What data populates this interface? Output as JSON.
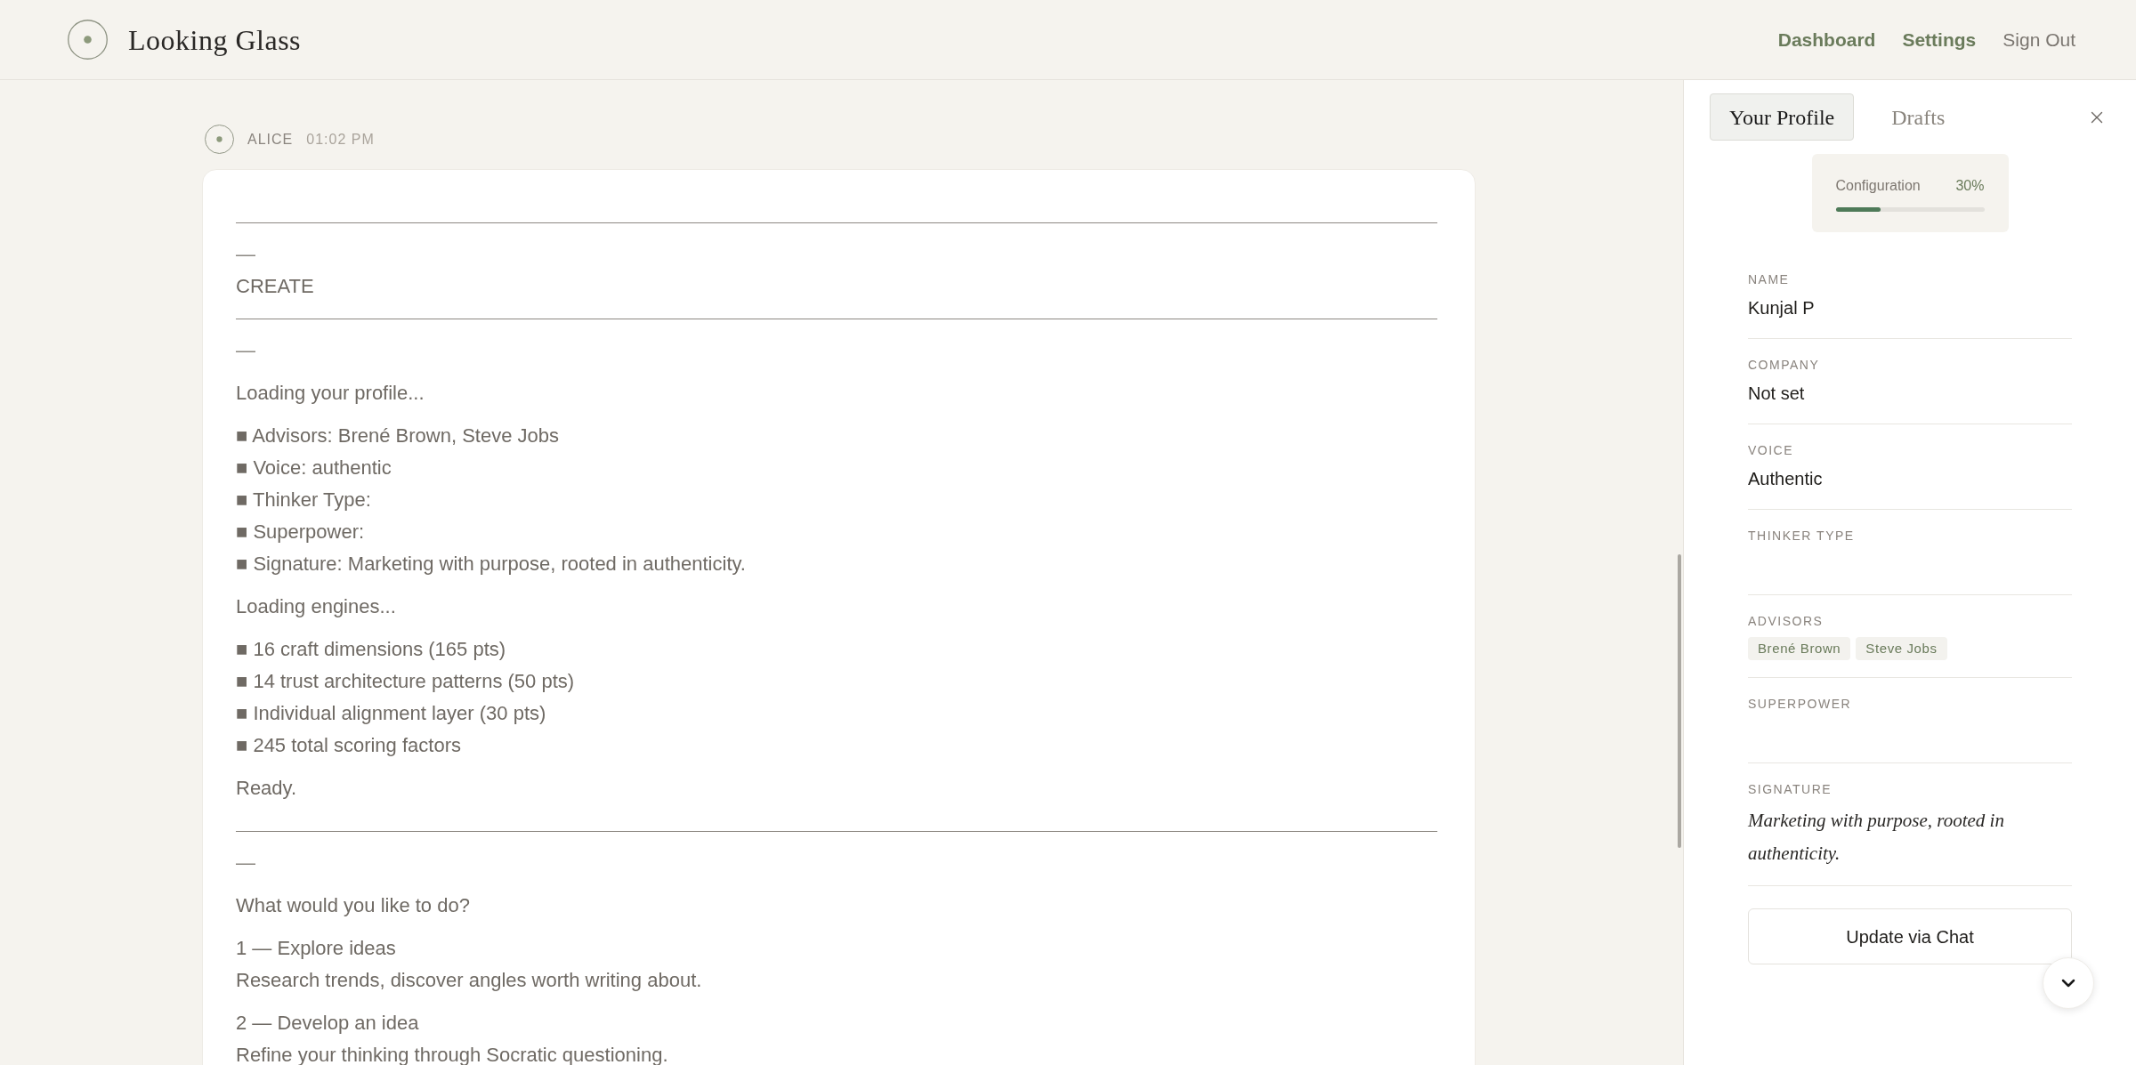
{
  "header": {
    "title": "Looking Glass",
    "links": [
      {
        "label": "Dashboard",
        "kind": "primary"
      },
      {
        "label": "Settings",
        "kind": "primary"
      },
      {
        "label": "Sign Out",
        "kind": "secondary"
      }
    ]
  },
  "message": {
    "sender": "ALICE",
    "time": "01:02 PM",
    "blocks": [
      {
        "kind": "rule"
      },
      {
        "kind": "dash",
        "text": "—"
      },
      {
        "kind": "heading",
        "text": "CREATE"
      },
      {
        "kind": "rule"
      },
      {
        "kind": "dash",
        "text": "—"
      },
      {
        "kind": "paragraph",
        "lines": [
          "Loading your profile..."
        ]
      },
      {
        "kind": "list",
        "items": [
          "■ Advisors: Brené Brown, Steve Jobs",
          "■ Voice: authentic",
          "■ Thinker Type:",
          "■ Superpower:",
          "■ Signature: Marketing with purpose, rooted in authenticity."
        ]
      },
      {
        "kind": "paragraph",
        "lines": [
          "Loading engines..."
        ]
      },
      {
        "kind": "list",
        "items": [
          "■ 16 craft dimensions (165 pts)",
          "■ 14 trust architecture patterns (50 pts)",
          "■ Individual alignment layer (30 pts)",
          "■ 245 total scoring factors"
        ]
      },
      {
        "kind": "paragraph",
        "lines": [
          "Ready."
        ]
      },
      {
        "kind": "rule"
      },
      {
        "kind": "dash",
        "text": "—"
      },
      {
        "kind": "paragraph",
        "lines": [
          "What would you like to do?"
        ]
      },
      {
        "kind": "paragraph",
        "lines": [
          "1 — Explore ideas",
          "Research trends, discover angles worth writing about."
        ]
      },
      {
        "kind": "paragraph",
        "lines": [
          "2 — Develop an idea",
          "Refine your thinking through Socratic questioning."
        ]
      }
    ]
  },
  "panel": {
    "tabs": [
      {
        "label": "Your Profile",
        "selected": true
      },
      {
        "label": "Drafts",
        "selected": false
      }
    ],
    "progress": {
      "label": "Configuration",
      "reading": "30%",
      "level": 0.3
    },
    "fields": [
      {
        "label": "NAME",
        "kind": "text",
        "value": "Kunjal P"
      },
      {
        "label": "COMPANY",
        "kind": "text",
        "value": "Not set"
      },
      {
        "label": "VOICE",
        "kind": "text",
        "value": "Authentic"
      },
      {
        "label": "THINKER TYPE",
        "kind": "text"
      },
      {
        "label": "ADVISORS",
        "kind": "tags",
        "tags": [
          "Brené Brown",
          "Steve Jobs"
        ]
      },
      {
        "label": "SUPERPOWER",
        "kind": "text"
      },
      {
        "label": "SIGNATURE",
        "kind": "quote",
        "value": "Marketing with purpose, rooted in authenticity."
      }
    ],
    "button": "Update via Chat"
  }
}
